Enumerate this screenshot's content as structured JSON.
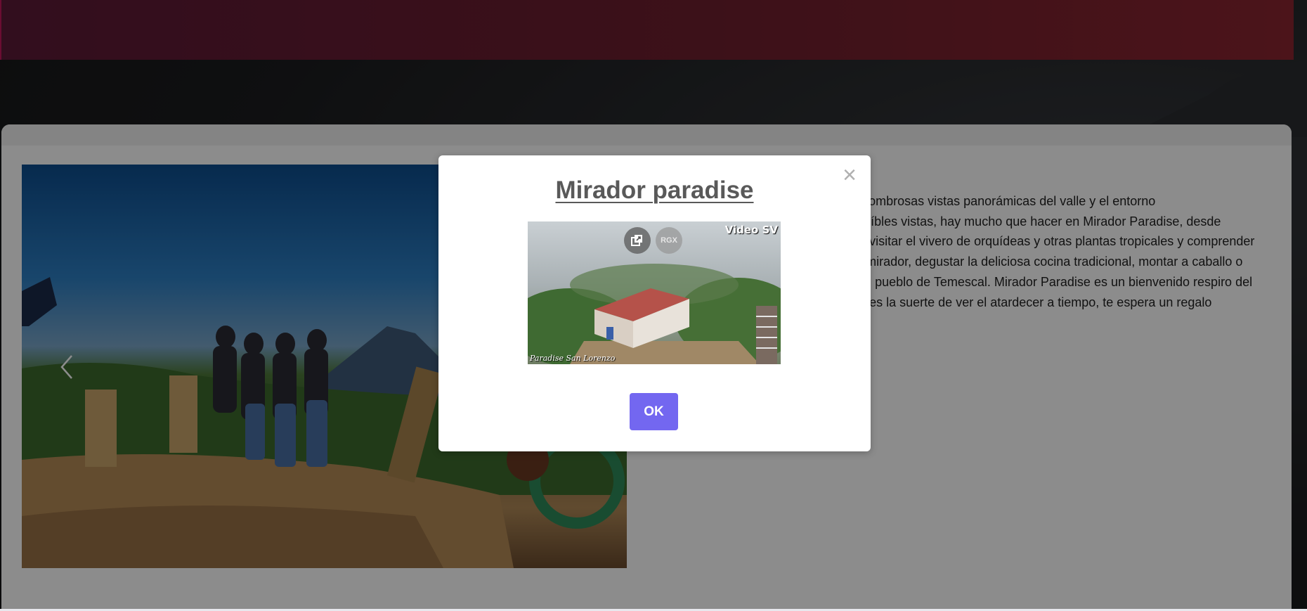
{
  "page": {
    "description_lines": [
      "Mirador Paradise ofrece asombrosas vistas panorámicas del valle y el entorno",
      "natural. Aparte de sus increíbles vistas, hay mucho que hacer en Mirador Paradise, desde",
      "caminar por sus senderos, visitar el vivero de orquídeas y otras plantas tropicales y comprender",
      "su importancia, admirar el mirador, degustar la deliciosa cocina tradicional, montar a caballo o",
      "recorrer los alrededores del pueblo de Temescal. Mirador Paradise es un bienvenido respiro del",
      "estrés de la ciudad y si tienes la suerte de ver el atardecer a tiempo, te espera un regalo impresionante."
    ],
    "carousel_prev_icon": "chevron-left-icon"
  },
  "modal": {
    "title": "Mirador paradise",
    "close_symbol": "×",
    "ok_label": "OK",
    "media": {
      "brand": "Video SV",
      "caption": "Paradise San Lorenzo",
      "share_icon": "share-icon",
      "rgx_label": "RGX"
    }
  },
  "colors": {
    "ok_button": "#7367f0",
    "topbar": "#6e1f2e",
    "title": "#595959"
  }
}
